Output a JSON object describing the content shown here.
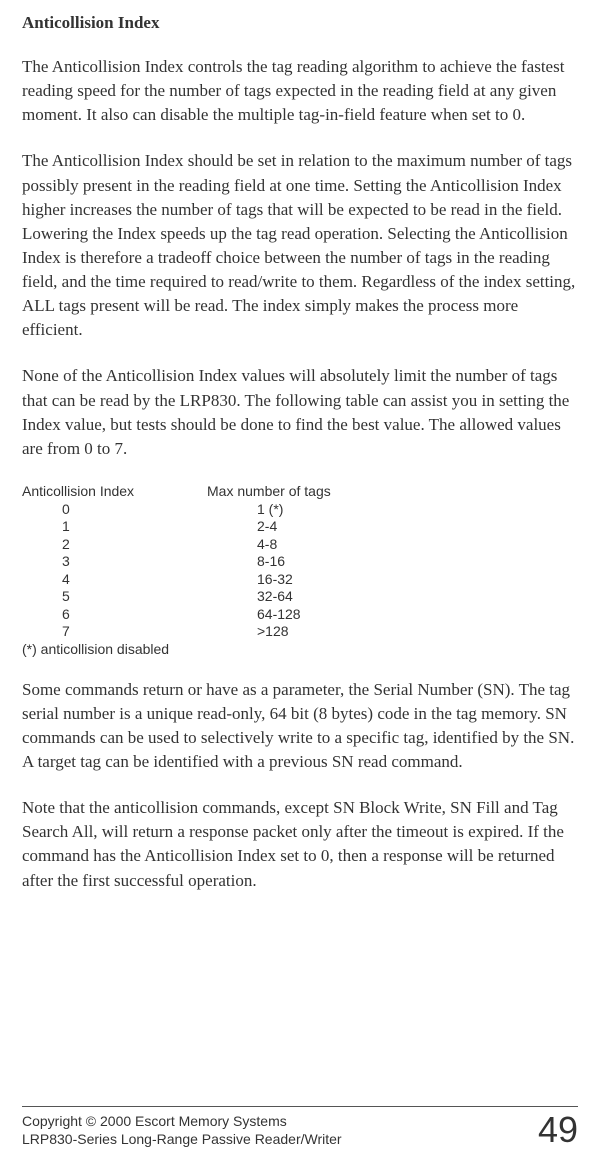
{
  "title": "Anticollision Index",
  "paragraphs": {
    "p1": "The Anticollision Index controls the tag reading algorithm to achieve the fastest reading speed for the number of tags expected in the reading field at any given moment. It also can disable the multiple tag-in-field feature when set to 0.",
    "p2": "The Anticollision Index should be set in relation to the maximum number of tags possibly present in the reading field at one time.  Setting the Anticollision Index higher increases the number of tags that will be expected to be read in the field.  Lowering the Index speeds up the tag read operation.  Selecting the Anticollision Index is therefore a tradeoff choice between the number of tags in the reading field, and the time required to read/write to them. Regardless of the index setting, ALL tags present will be read. The index simply makes the process more efficient.",
    "p3": "None of the Anticollision Index values will absolutely limit the number of tags that can be read by the LRP830.  The following table can assist you in setting the Index value, but tests should be done to find the best value.  The allowed values are from 0 to 7.",
    "p4": "Some commands return or have as a parameter, the Serial Number (SN). The tag serial number is a unique read-only, 64 bit (8 bytes) code in the tag memory. SN commands  can be used to selectively write to a specific tag, identified by the SN. A target tag can be identified with a previous SN read command.",
    "p5": "Note that the anticollision commands, except SN Block Write, SN Fill and Tag Search All, will return a response packet only after the timeout is expired.  If the command has the Anticollision Index set to 0, then a response will be returned after the first successful operation."
  },
  "table": {
    "header_left": "Anticollision Index",
    "header_right": "Max number of tags",
    "rows": [
      {
        "index": "0",
        "tags": "1 (*)"
      },
      {
        "index": "1",
        "tags": "2-4"
      },
      {
        "index": "2",
        "tags": "4-8"
      },
      {
        "index": "3",
        "tags": "8-16"
      },
      {
        "index": "4",
        "tags": "16-32"
      },
      {
        "index": "5",
        "tags": "32-64"
      },
      {
        "index": "6",
        "tags": "64-128"
      },
      {
        "index": "7",
        "tags": ">128"
      }
    ],
    "footnote": "(*) anticollision disabled"
  },
  "footer": {
    "copyright": "Copyright © 2000 Escort Memory Systems",
    "product": "LRP830-Series Long-Range Passive Reader/Writer",
    "page_number": "49"
  }
}
